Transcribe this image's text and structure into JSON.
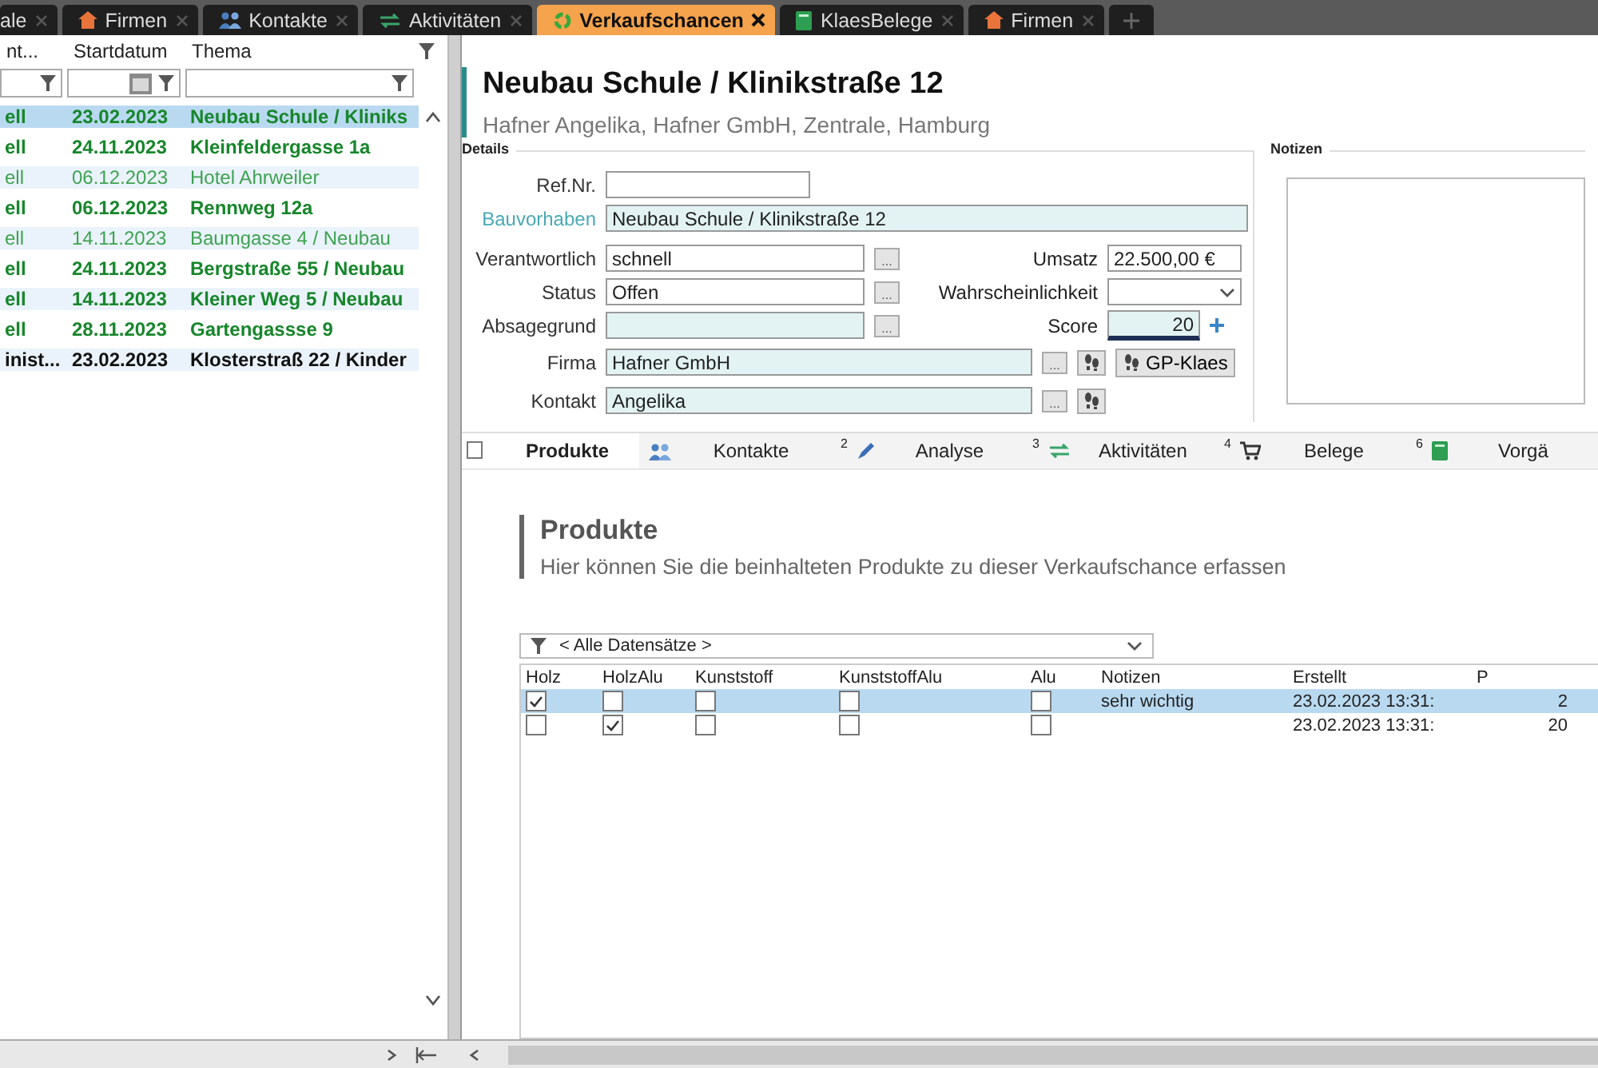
{
  "top_tabs": [
    {
      "label": "ale",
      "selected": false
    },
    {
      "label": "Firmen",
      "selected": false
    },
    {
      "label": "Kontakte",
      "selected": false
    },
    {
      "label": "Aktivitäten",
      "selected": false
    },
    {
      "label": "Verkaufschancen",
      "selected": true
    },
    {
      "label": "KlaesBelege",
      "selected": false
    },
    {
      "label": "Firmen",
      "selected": false
    }
  ],
  "list": {
    "columns": [
      "nt...",
      "Startdatum",
      "Thema"
    ],
    "rows": [
      {
        "cells": [
          "ell",
          "23.02.2023",
          "Neubau Schule / Kliniks"
        ],
        "kind": "strong",
        "selected": true
      },
      {
        "cells": [
          "ell",
          "24.11.2023",
          "Kleinfeldergasse 1a"
        ],
        "kind": "strong",
        "selected": false
      },
      {
        "cells": [
          "ell",
          "06.12.2023",
          "Hotel Ahrweiler"
        ],
        "kind": "faint",
        "selected": false
      },
      {
        "cells": [
          "ell",
          "06.12.2023",
          "Rennweg 12a"
        ],
        "kind": "strong",
        "selected": false
      },
      {
        "cells": [
          "ell",
          "14.11.2023",
          "Baumgasse 4 / Neubau"
        ],
        "kind": "faint",
        "selected": false
      },
      {
        "cells": [
          "ell",
          "24.11.2023",
          "Bergstraße 55 / Neubau"
        ],
        "kind": "strong",
        "selected": false
      },
      {
        "cells": [
          "ell",
          "14.11.2023",
          "Kleiner Weg 5 / Neubau"
        ],
        "kind": "strong",
        "selected": false
      },
      {
        "cells": [
          "ell",
          "28.11.2023",
          "Gartengassse 9"
        ],
        "kind": "strong",
        "selected": false
      },
      {
        "cells": [
          "inist...",
          "23.02.2023",
          "Klosterstraß 22 / Kinder"
        ],
        "kind": "dark",
        "selected": false
      }
    ]
  },
  "record": {
    "title": "Neubau Schule / Klinikstraße 12",
    "subtitle": "Hafner Angelika, Hafner GmbH, Zentrale, Hamburg"
  },
  "details": {
    "legend": "Details",
    "ref_nr": {
      "label": "Ref.Nr."
    },
    "bauvorhaben": {
      "label": "Bauvorhaben",
      "value": "Neubau Schule / Klinikstraße 12"
    },
    "verantwortlich": {
      "label": "Verantwortlich",
      "value": "schnell"
    },
    "status": {
      "label": "Status",
      "value": "Offen"
    },
    "absagegrund": {
      "label": "Absagegrund"
    },
    "umsatz": {
      "label": "Umsatz",
      "value": "22.500,00 €"
    },
    "wahrscheinlichkeit": {
      "label": "Wahrscheinlichkeit"
    },
    "score": {
      "label": "Score",
      "value": "20"
    },
    "firma": {
      "label": "Firma",
      "value": "Hafner GmbH"
    },
    "kontakt": {
      "label": "Kontakt",
      "value": "Angelika"
    },
    "browse_button": "...",
    "gp_button": "GP-Klaes"
  },
  "notes": {
    "legend": "Notizen"
  },
  "tab_checkbox": {
    "checked": false
  },
  "sub_tabs": [
    {
      "label": "Produkte",
      "selected": true
    },
    {
      "label": "Kontakte",
      "selected": false
    },
    {
      "label": "Analyse",
      "badge": "2",
      "selected": false
    },
    {
      "label": "Aktivitäten",
      "badge": "3",
      "selected": false
    },
    {
      "label": "Belege",
      "badge": "4",
      "selected": false
    },
    {
      "label": "Vorgä",
      "badge": "6",
      "selected": false
    }
  ],
  "section": {
    "title": "Produkte",
    "description": "Hier können Sie die beinhalteten Produkte zu dieser Verkaufschance erfassen"
  },
  "filter": {
    "value": "< Alle Datensätze >"
  },
  "grid": {
    "columns": [
      "Holz",
      "HolzAlu",
      "Kunststoff",
      "KunststoffAlu",
      "Alu",
      "Notizen",
      "Erstellt",
      "P"
    ],
    "rows": [
      {
        "checks": [
          true,
          false,
          false,
          false,
          false
        ],
        "notizen": "sehr wichtig",
        "erstellt": "23.02.2023 13:31:",
        "p": "2",
        "selected": true
      },
      {
        "checks": [
          false,
          true,
          false,
          false,
          false
        ],
        "erstellt": "23.02.2023 13:31:",
        "p": "20",
        "selected": false
      }
    ]
  }
}
